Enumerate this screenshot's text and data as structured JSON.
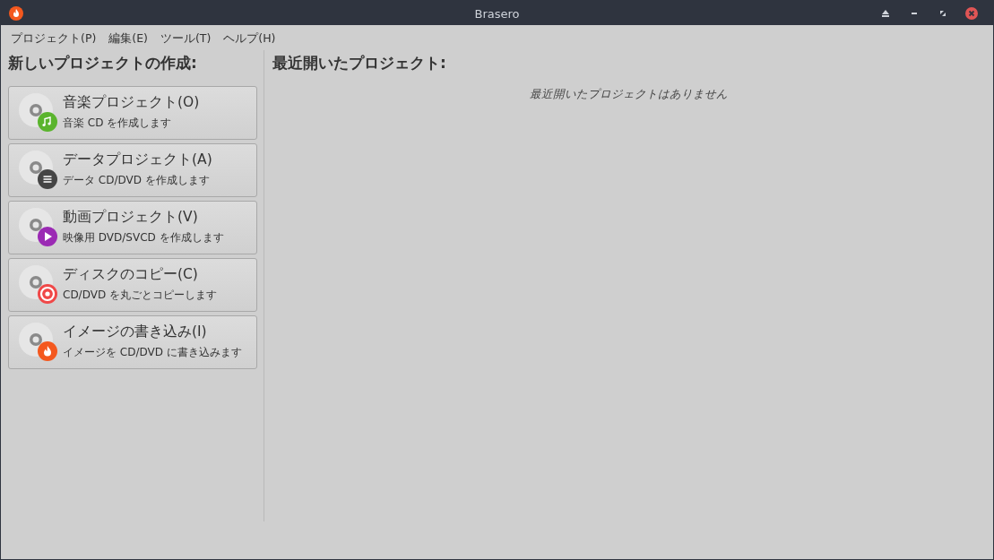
{
  "window": {
    "title": "Brasero"
  },
  "menu": [
    "プロジェクト(P)",
    "編集(E)",
    "ツール(T)",
    "ヘルプ(H)"
  ],
  "new_project": {
    "heading": "新しいプロジェクトの作成:",
    "items": [
      {
        "kind": "music",
        "color": "#5ab42d",
        "title": "音楽プロジェクト(O)",
        "description": "音楽 CD を作成します"
      },
      {
        "kind": "data",
        "color": "#444444",
        "title": "データプロジェクト(A)",
        "description": "データ CD/DVD を作成します"
      },
      {
        "kind": "video",
        "color": "#9b2ab4",
        "title": "動画プロジェクト(V)",
        "description": "映像用 DVD/SVCD を作成します"
      },
      {
        "kind": "copy",
        "color": "#f04848",
        "title": "ディスクのコピー(C)",
        "description": "CD/DVD を丸ごとコピーします"
      },
      {
        "kind": "image",
        "color": "#f4581e",
        "title": "イメージの書き込み(I)",
        "description": "イメージを CD/DVD に書き込みます"
      }
    ]
  },
  "recent": {
    "heading": "最近開いたプロジェクト:",
    "empty_message": "最近開いたプロジェクトはありません"
  }
}
